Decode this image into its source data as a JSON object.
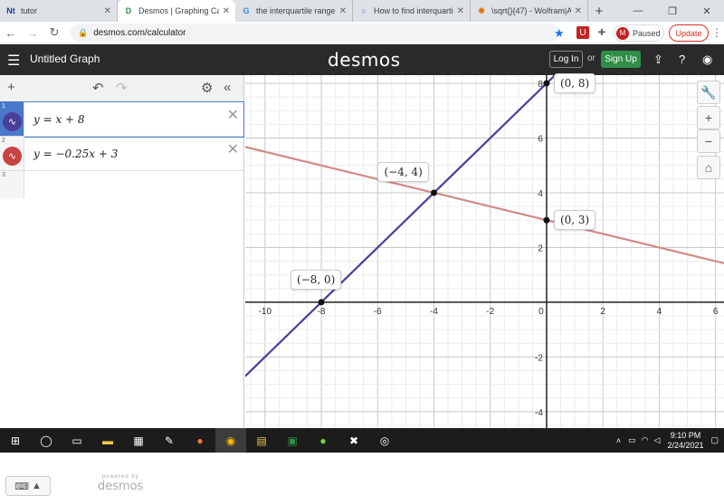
{
  "tabs": [
    {
      "label": "tutor",
      "favicon": "Nt",
      "color": "#1f3a93",
      "active": false
    },
    {
      "label": "Desmos | Graphing Calcu",
      "favicon": "D",
      "color": "#2f8f46",
      "active": true
    },
    {
      "label": "the interquartile range i",
      "favicon": "G",
      "color": "#4285f4",
      "active": false
    },
    {
      "label": "How to find interquartile",
      "favicon": "○",
      "color": "#5b5bd6",
      "active": false
    },
    {
      "label": "\\sqrt{}{47} - Wolfram|Alph",
      "favicon": "✹",
      "color": "#e8710a",
      "active": false
    }
  ],
  "browser": {
    "url": "desmos.com/calculator",
    "paused_label": "Paused",
    "profile_initial": "M",
    "update_label": "Update"
  },
  "header": {
    "graph_title": "Untitled Graph",
    "logo": "desmos",
    "login_label": "Log In",
    "or_label": "or",
    "signup_label": "Sign Up"
  },
  "expressions": [
    {
      "index": "1",
      "latex": "y = x + 8",
      "color": "#4a3f9a",
      "active": true
    },
    {
      "index": "2",
      "latex": "y = −0.25x + 3",
      "color": "#c74440",
      "active": false
    },
    {
      "index": "3",
      "latex": "",
      "color": "",
      "active": false
    }
  ],
  "powered": {
    "small": "powered by",
    "brand": "desmos"
  },
  "chart_data": {
    "type": "line",
    "x_range": [
      -10.7,
      6.3
    ],
    "y_range": [
      -4.6,
      8.3
    ],
    "x_ticks": [
      "-10",
      "-8",
      "-6",
      "-4",
      "-2",
      "0",
      "2",
      "4",
      "6"
    ],
    "y_ticks": [
      "-4",
      "-2",
      "2",
      "4",
      "6",
      "8"
    ],
    "grid": true,
    "series": [
      {
        "expression": "y = x + 8",
        "slope": 1,
        "intercept": 8,
        "color": "#4a3f9a"
      },
      {
        "expression": "y = -0.25x + 3",
        "slope": -0.25,
        "intercept": 3,
        "color": "#d08b86"
      }
    ],
    "points": [
      {
        "x": -8,
        "y": 0,
        "label": "(−8, 0)",
        "label_pos": "above"
      },
      {
        "x": -4,
        "y": 4,
        "label": "(−4, 4)",
        "label_pos": "above-left"
      },
      {
        "x": 0,
        "y": 8,
        "label": "(0, 8)",
        "label_pos": "right"
      },
      {
        "x": 0,
        "y": 3,
        "label": "(0, 3)",
        "label_pos": "right"
      }
    ]
  },
  "taskbar": {
    "time": "9:10 PM",
    "date": "2/24/2021"
  }
}
